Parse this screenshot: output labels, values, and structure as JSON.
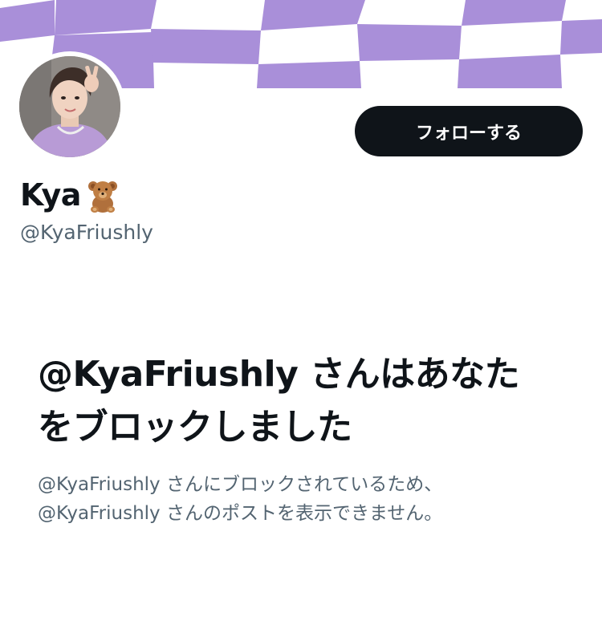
{
  "profile": {
    "display_name": "Kya",
    "name_emoji": "teddy-bear-icon",
    "handle": "@KyaFriushly",
    "follow_label": "フォローする"
  },
  "blocked_notice": {
    "title": "@KyaFriushly さんはあなたをブロックしました",
    "description_line1": "@KyaFriushly さんにブロックされているため、",
    "description_line2": "@KyaFriushly さんのポストを表示できません。"
  },
  "colors": {
    "banner_purple": "#a98fd9",
    "button_bg": "#0f1419",
    "secondary_text": "#536471"
  }
}
